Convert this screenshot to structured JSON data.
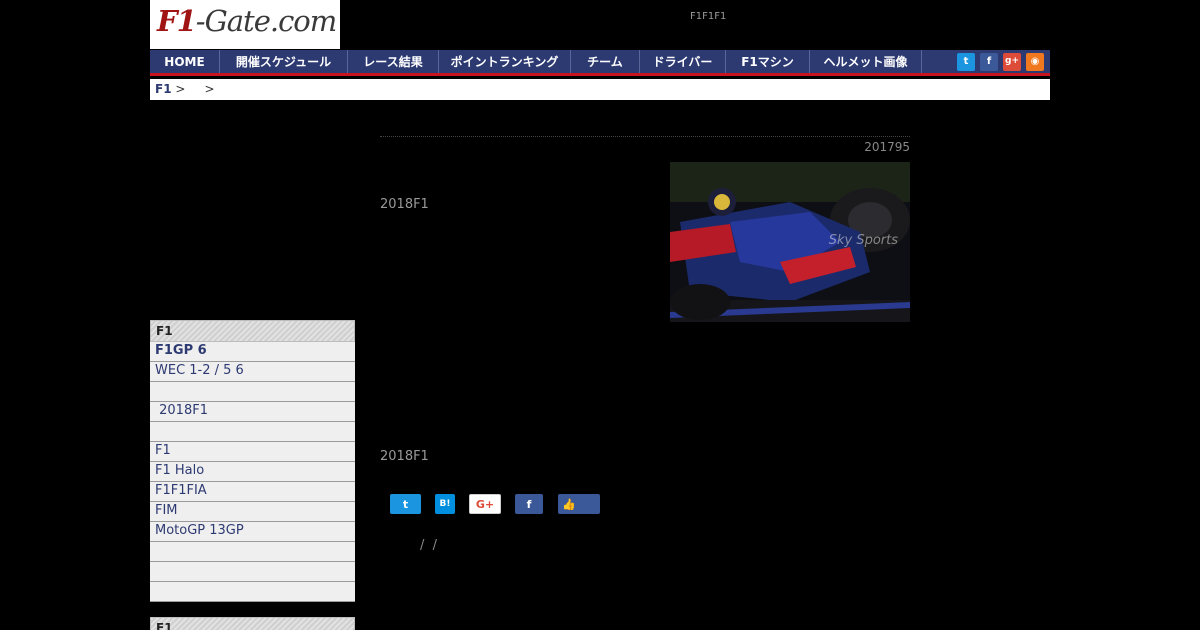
{
  "header": {
    "logo_f1": "F1",
    "logo_rest": "-Gate.com",
    "tagline": "F1F1F1"
  },
  "nav": {
    "items": [
      {
        "label": "HOME"
      },
      {
        "label": "開催スケジュール"
      },
      {
        "label": "レース結果"
      },
      {
        "label": "ポイントランキング"
      },
      {
        "label": "チーム"
      },
      {
        "label": "ドライバー"
      },
      {
        "label": "F1マシン"
      },
      {
        "label": "ヘルメット画像"
      }
    ],
    "social": {
      "twitter_glyph": "t",
      "facebook_glyph": "f",
      "gplus_glyph": "g+",
      "rss_glyph": "◉"
    }
  },
  "breadcrumb": {
    "home": "F1",
    "sep1": " >     >"
  },
  "sidebar": {
    "heading": "F1",
    "items": [
      {
        "label": "F1GP 6",
        "bold": true
      },
      {
        "label": "WEC 1-2 / 5 6",
        "bold": false
      },
      {
        "label": "",
        "bold": false
      },
      {
        "label": " 2018F1",
        "bold": false
      },
      {
        "label": "",
        "bold": false
      },
      {
        "label": "F1",
        "bold": false
      },
      {
        "label": "F1 Halo",
        "bold": false
      },
      {
        "label": "F1F1FIA",
        "bold": false
      },
      {
        "label": "FIM",
        "bold": false
      },
      {
        "label": "MotoGP 13GP",
        "bold": false
      },
      {
        "label": "",
        "bold": false
      },
      {
        "label": "",
        "bold": false
      },
      {
        "label": "",
        "bold": false
      }
    ],
    "heading2": "F1"
  },
  "article": {
    "date": "201795",
    "lead": "2018F1",
    "body": "2018F1",
    "photo_credit": "Sky Sports",
    "separators": "/  /"
  },
  "share": {
    "twitter_glyph": "t",
    "hatena_glyph": "B!",
    "gplus_glyph": "G+",
    "facebook_glyph": "f",
    "like_glyph": "👍"
  },
  "colors": {
    "nav_bg": "#2d3a72",
    "nav_border": "#c8141e",
    "twitter": "#1b95e0",
    "hatena": "#008fde",
    "facebook": "#3b5998",
    "gplus": "#dd4b39",
    "rss": "#f0781e"
  }
}
